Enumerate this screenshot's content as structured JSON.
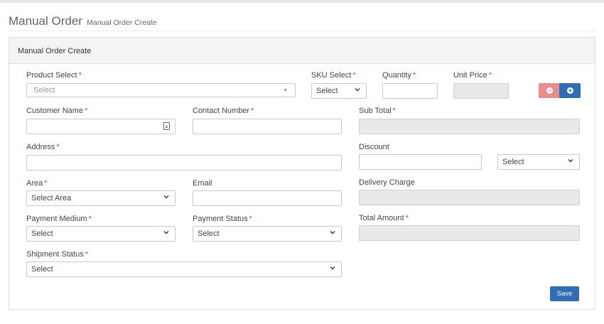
{
  "page": {
    "title": "Manual Order",
    "subtitle": "Manual Order Create"
  },
  "card": {
    "title": "Manual Order Create"
  },
  "form": {
    "product_select": {
      "label": "Product Select",
      "value": "Select"
    },
    "sku_select": {
      "label": "SKU Select",
      "value": "Select"
    },
    "quantity": {
      "label": "Quantity",
      "value": ""
    },
    "unit_price": {
      "label": "Unit Price",
      "value": ""
    },
    "customer_name": {
      "label": "Customer Name",
      "value": ""
    },
    "contact_number": {
      "label": "Contact Number",
      "value": ""
    },
    "sub_total": {
      "label": "Sub Total",
      "value": ""
    },
    "address": {
      "label": "Address",
      "value": ""
    },
    "discount": {
      "label": "Discount",
      "value": "",
      "type_value": "Select"
    },
    "area": {
      "label": "Area",
      "value": "Select Area"
    },
    "email": {
      "label": "Email",
      "value": ""
    },
    "delivery_charge": {
      "label": "Delivery Charge",
      "value": ""
    },
    "payment_medium": {
      "label": "Payment Medium",
      "value": "Select"
    },
    "payment_status": {
      "label": "Payment Status",
      "value": "Select"
    },
    "total_amount": {
      "label": "Total Amount",
      "value": ""
    },
    "shipment_status": {
      "label": "Shipment Status",
      "value": "Select"
    },
    "required_marker": "*"
  },
  "buttons": {
    "save_label": "Save"
  },
  "colors": {
    "primary": "#2f6eb5",
    "danger_light": "#e88c8c",
    "required": "#e53935",
    "disabled_bg": "#e9e9e9"
  }
}
